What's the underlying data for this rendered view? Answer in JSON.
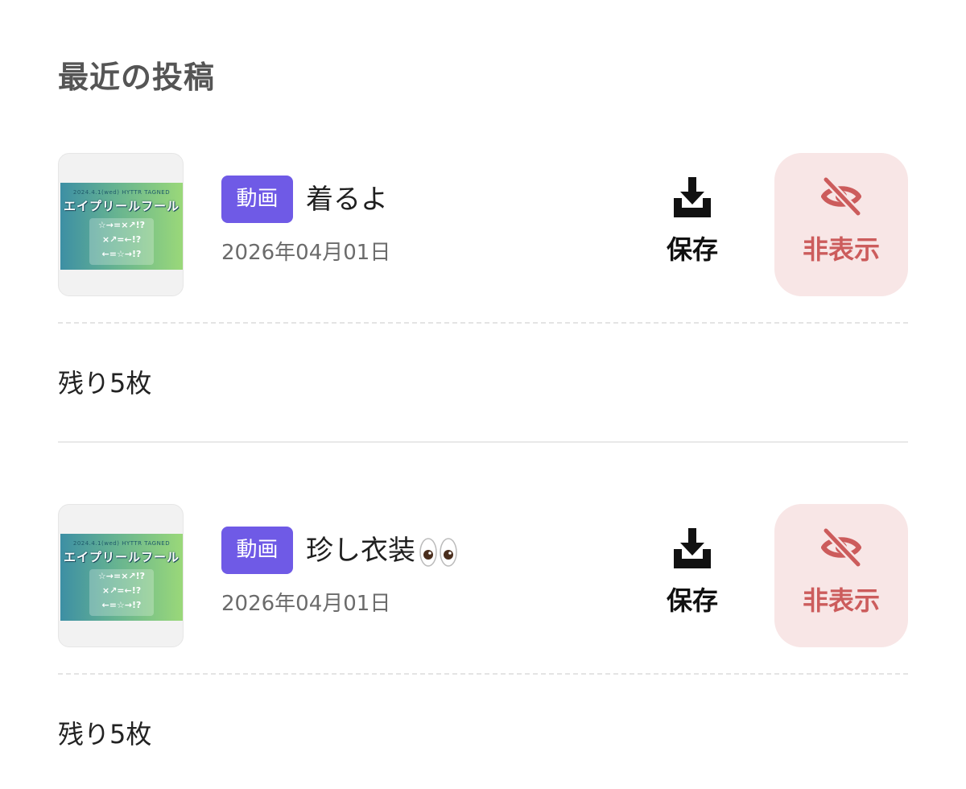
{
  "section": {
    "title": "最近の投稿"
  },
  "posts": [
    {
      "badge": "動画",
      "title": "着るよ",
      "title_emoji": "",
      "date": "2026年04月01日",
      "save_label": "保存",
      "hide_label": "非表示",
      "remaining": "残り5枚",
      "thumbnail": {
        "caption": "2024.4.1(wed) HYTTR TAGNED",
        "title": "エイプリールフール",
        "lines": [
          "☆→=×↗!?",
          "×↗=←!?",
          "←=☆→!?"
        ]
      }
    },
    {
      "badge": "動画",
      "title": "珍し衣装",
      "title_emoji": "eyes-emoji",
      "date": "2026年04月01日",
      "save_label": "保存",
      "hide_label": "非表示",
      "remaining": "残り5枚",
      "thumbnail": {
        "caption": "2024.4.1(wed) HYTTR TAGNED",
        "title": "エイプリールフール",
        "lines": [
          "☆→=×↗!?",
          "×↗=←!?",
          "←=☆→!?"
        ]
      }
    }
  ],
  "colors": {
    "badge_bg": "#6f5ae6",
    "hide_bg": "#f8e6e6",
    "hide_fg": "#cc5c5c",
    "title_fg": "#555555"
  },
  "icons": {
    "save": "download-tray-icon",
    "hide": "eye-slash-icon"
  }
}
